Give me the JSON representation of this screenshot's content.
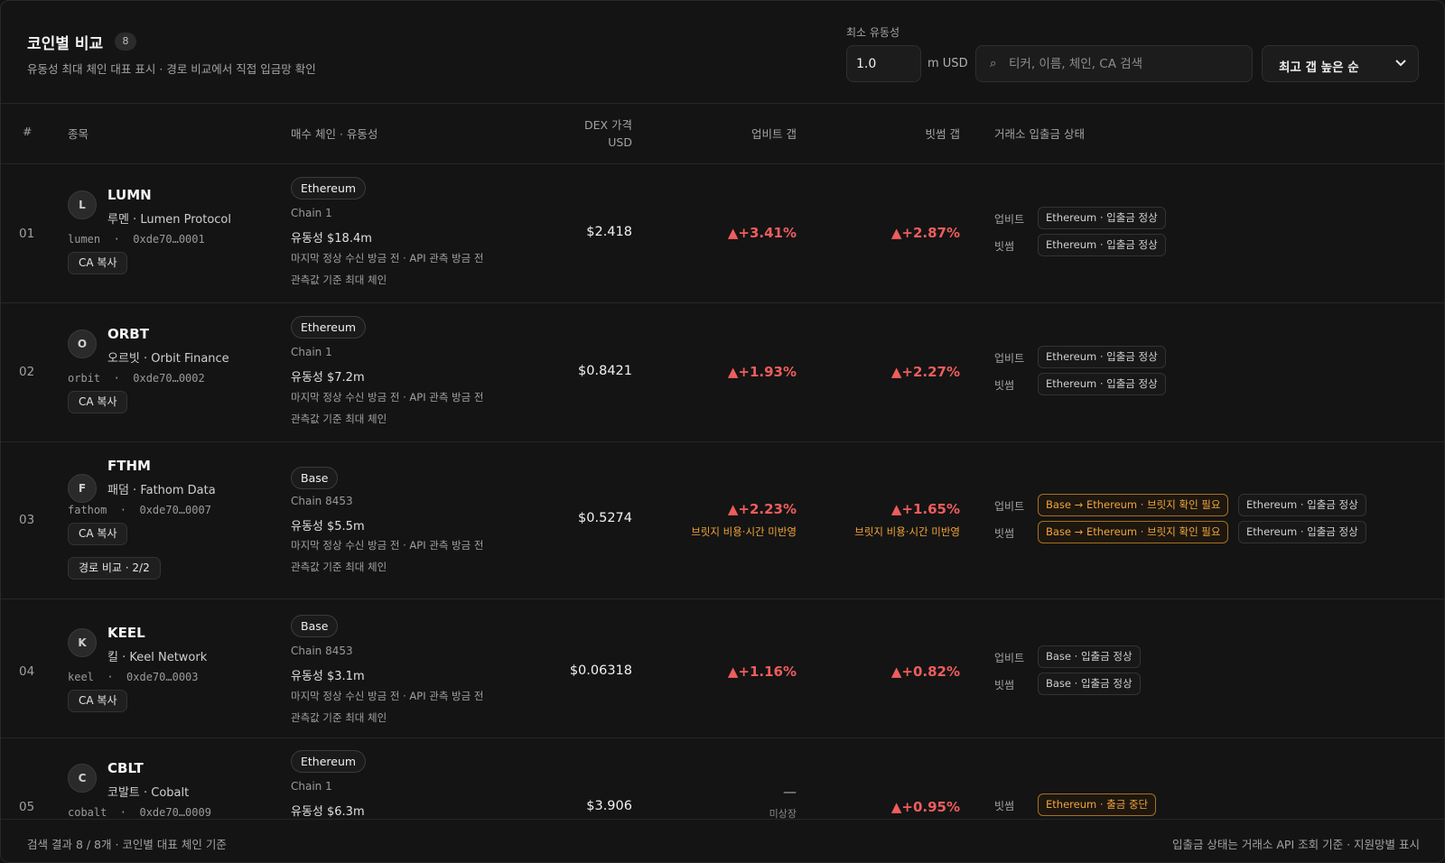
{
  "header": {
    "title": "코인별 비교",
    "count": "8",
    "subtitle": "유동성 최대 체인 대표 표시 · 경로 비교에서 직접 입금망 확인",
    "min_liquidity_label": "최소 유동성",
    "min_liquidity_value": "1.0",
    "min_liquidity_unit": "m USD",
    "search_placeholder": "티커, 이름, 체인, CA 검색",
    "sort_label": "최고 갭 높은 순"
  },
  "columns": {
    "num": "#",
    "item": "종목",
    "chain": "매수 체인 · 유동성",
    "dex_price": "DEX 가격",
    "dex_unit": "USD",
    "upbit_gap": "업비트 갭",
    "bithumb_gap": "빗썸 갭",
    "status": "거래소 입출금 상태"
  },
  "rows": [
    {
      "num": "01",
      "initial": "L",
      "ticker": "LUMN",
      "name": "루멘 · Lumen Protocol",
      "ca": "lumen  ·  0xde70…0001",
      "ca_button": "CA 복사",
      "chain": "Ethereum",
      "chain_id": "Chain 1",
      "liquidity": "유동성 $18.4m",
      "note1": "마지막 정상 수신 방금 전 · API 관측 방금 전",
      "note2": "관측값 기준 최대 체인",
      "price": "$2.418",
      "upbit_gap": "▲+3.41%",
      "bithumb_gap": "▲+2.87%",
      "upbit_label": "업비트",
      "bithumb_label": "빗썸",
      "upbit_tags": [
        "Ethereum · 입출금 정상"
      ],
      "bithumb_tags": [
        "Ethereum · 입출금 정상"
      ]
    },
    {
      "num": "02",
      "initial": "O",
      "ticker": "ORBT",
      "name": "오르빗 · Orbit Finance",
      "ca": "orbit  ·  0xde70…0002",
      "ca_button": "CA 복사",
      "chain": "Ethereum",
      "chain_id": "Chain 1",
      "liquidity": "유동성 $7.2m",
      "note1": "마지막 정상 수신 방금 전 · API 관측 방금 전",
      "note2": "관측값 기준 최대 체인",
      "price": "$0.8421",
      "upbit_gap": "▲+1.93%",
      "bithumb_gap": "▲+2.27%",
      "upbit_label": "업비트",
      "bithumb_label": "빗썸",
      "upbit_tags": [
        "Ethereum · 입출금 정상"
      ],
      "bithumb_tags": [
        "Ethereum · 입출금 정상"
      ]
    },
    {
      "num": "03",
      "initial": "F",
      "ticker": "FTHM",
      "name": "패덤 · Fathom Data",
      "ca": "fathom  ·  0xde70…0007",
      "ca_button": "CA 복사",
      "route_button": "경로 비교 · 2/2",
      "chain": "Base",
      "chain_id": "Chain 8453",
      "liquidity": "유동성 $5.5m",
      "note1": "마지막 정상 수신 방금 전 · API 관측 방금 전",
      "note2": "관측값 기준 최대 체인",
      "price": "$0.5274",
      "upbit_gap": "▲+2.23%",
      "bithumb_gap": "▲+1.65%",
      "upbit_warn": "브릿지 비용·시간 미반영",
      "bithumb_warn": "브릿지 비용·시간 미반영",
      "upbit_label": "업비트",
      "bithumb_label": "빗썸",
      "upbit_tags": [
        "Base → Ethereum · 브릿지 확인 필요",
        "Ethereum · 입출금 정상"
      ],
      "bithumb_tags": [
        "Base → Ethereum · 브릿지 확인 필요",
        "Ethereum · 입출금 정상"
      ]
    },
    {
      "num": "04",
      "initial": "K",
      "ticker": "KEEL",
      "name": "킬 · Keel Network",
      "ca": "keel  ·  0xde70…0003",
      "ca_button": "CA 복사",
      "chain": "Base",
      "chain_id": "Chain 8453",
      "liquidity": "유동성 $3.1m",
      "note1": "마지막 정상 수신 방금 전 · API 관측 방금 전",
      "note2": "관측값 기준 최대 체인",
      "price": "$0.06318",
      "upbit_gap": "▲+1.16%",
      "bithumb_gap": "▲+0.82%",
      "upbit_label": "업비트",
      "bithumb_label": "빗썸",
      "upbit_tags": [
        "Base · 입출금 정상"
      ],
      "bithumb_tags": [
        "Base · 입출금 정상"
      ]
    },
    {
      "num": "05",
      "initial": "C",
      "ticker": "CBLT",
      "name": "코발트 · Cobalt",
      "ca": "cobalt  ·  0xde70…0009",
      "chain": "Ethereum",
      "chain_id": "Chain 1",
      "liquidity": "유동성 $6.3m",
      "price": "$3.906",
      "upbit_gap": "—",
      "upbit_sub": "미상장",
      "bithumb_gap": "▲+0.95%",
      "bithumb_label": "빗썸",
      "bithumb_tags": [
        "Ethereum · 출금 중단"
      ]
    }
  ],
  "footer": {
    "left": "검색 결과 8 / 8개 · 코인별 대표 체인 기준",
    "right": "입출금 상태는 거래소 API 조회 기준 · 지원망별 표시"
  }
}
